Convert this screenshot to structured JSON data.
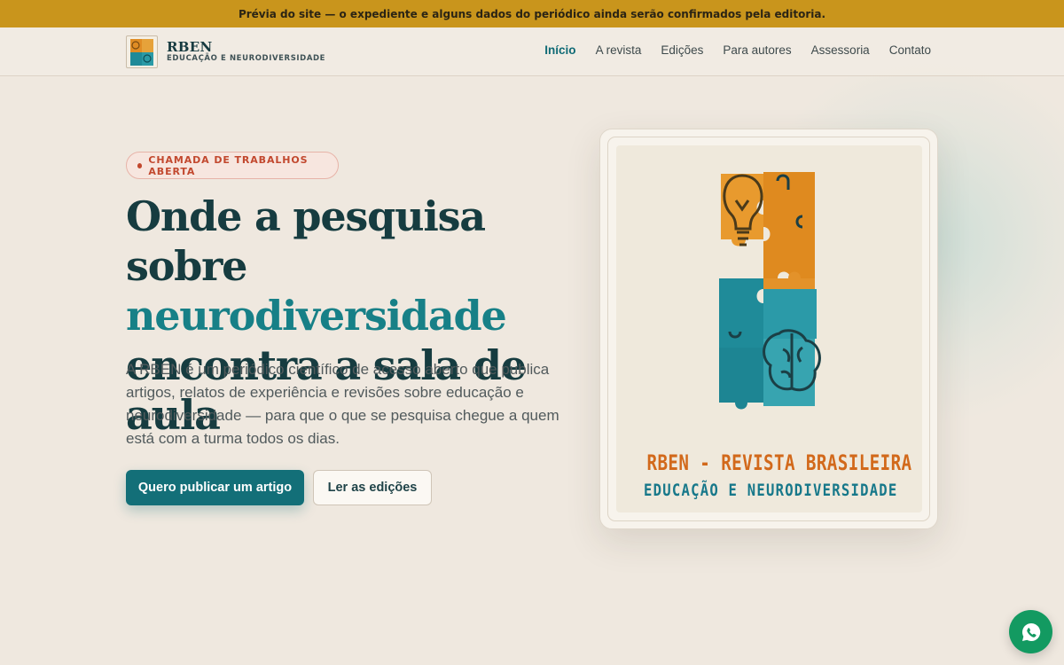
{
  "notice_bar": {
    "text": "Prévia do site — o expediente e alguns dados do periódico ainda serão confirmados pela editoria."
  },
  "header": {
    "logo_title": "RBEN",
    "logo_subtitle": "EDUCAÇÃO E NEURODIVERSIDADE",
    "nav": [
      {
        "label": "Início",
        "active": true
      },
      {
        "label": "A revista",
        "active": false
      },
      {
        "label": "Edições",
        "active": false
      },
      {
        "label": "Para autores",
        "active": false
      },
      {
        "label": "Assessoria",
        "active": false
      },
      {
        "label": "Contato",
        "active": false
      }
    ]
  },
  "hero": {
    "badge": "CHAMADA DE TRABALHOS ABERTA",
    "headline_line1": "Onde a pesquisa sobre",
    "headline_accent": "neurodiversidade",
    "headline_line3": "encontra a sala de aula",
    "lead": "A RBEN é um periódico científico de acesso aberto que publica artigos, relatos de experiência e revisões sobre educação e neurodiversidade — para que o que se pesquisa chegue a quem está com a turma todos os dias.",
    "primary_cta": "Quero publicar um artigo",
    "secondary_cta": "Ler as edições"
  },
  "cover": {
    "title_line1": "RBEN - REVISTA BRASILEIRA DE",
    "title_line2": "EDUCAÇÃO E NEURODIVERSIDADE",
    "icons": [
      "lightbulb-icon",
      "puzzle-icon",
      "brain-icon"
    ]
  },
  "floating": {
    "icon": "whatsapp-icon"
  },
  "colors": {
    "notice_bar": "#c9951c",
    "primary": "#136f78",
    "accent_text": "#178087",
    "badge": "#c2482e",
    "whatsapp": "#139a61",
    "background": "#efe8df"
  }
}
